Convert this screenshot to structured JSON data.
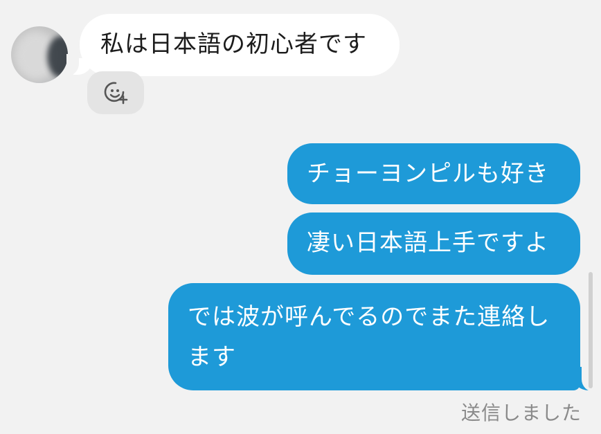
{
  "messages": {
    "incoming": [
      {
        "text": "私は日本語の初心者です"
      }
    ],
    "outgoing": [
      {
        "text": "チョーヨンピルも好き"
      },
      {
        "text": "凄い日本語上手ですよ"
      },
      {
        "text": "では波が呼んでるのでまた連絡します"
      }
    ]
  },
  "status": {
    "label": "送信しました"
  },
  "icons": {
    "reaction": "add-reaction-icon"
  },
  "colors": {
    "outgoing_bubble": "#1e9ad8",
    "incoming_bubble": "#ffffff",
    "background": "#f2f2f2",
    "status_text": "#8a8a8a"
  }
}
